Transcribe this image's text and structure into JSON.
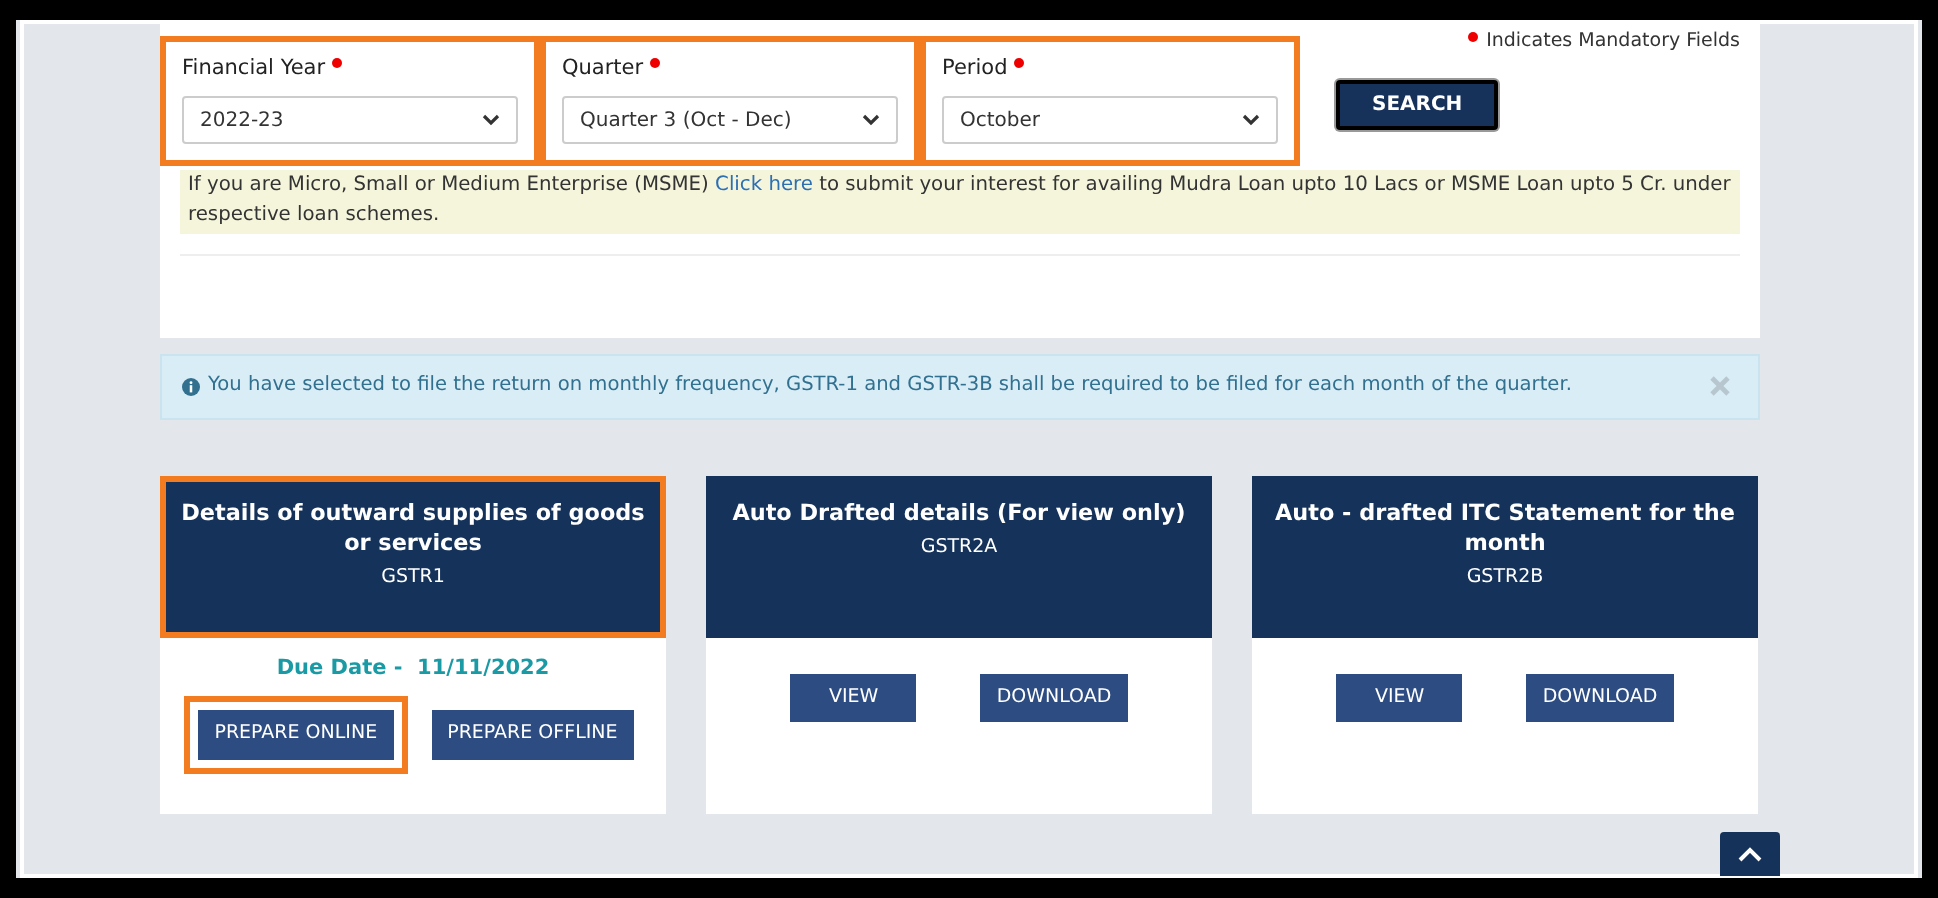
{
  "mandatory_note": {
    "text": "Indicates Mandatory Fields"
  },
  "filters": [
    {
      "label": "Financial Year",
      "value": "2022-23",
      "required": true,
      "highlighted": true
    },
    {
      "label": "Quarter",
      "value": "Quarter 3 (Oct - Dec)",
      "required": true,
      "highlighted": true
    },
    {
      "label": "Period",
      "value": "October",
      "required": true,
      "highlighted": true
    }
  ],
  "search_button": "SEARCH",
  "msme_notice": {
    "before": "If you are Micro, Small or Medium Enterprise (MSME)",
    "link": "Click here",
    "after": "to submit your interest for availing Mudra Loan upto 10 Lacs or MSME Loan upto 5 Cr. under respective loan schemes."
  },
  "info_alert": {
    "text": "You have selected to file the return on monthly frequency, GSTR-1 and GSTR-3B shall be required to be filed for each month of the quarter."
  },
  "tiles": [
    {
      "title": "Details of outward supplies of goods or services",
      "code": "GSTR1",
      "highlighted": true,
      "due_label": "Due Date -",
      "due_date": "11/11/2022",
      "buttons": [
        {
          "label": "PREPARE ONLINE",
          "highlighted": true
        },
        {
          "label": "PREPARE OFFLINE",
          "highlighted": false
        }
      ]
    },
    {
      "title": "Auto Drafted details (For view only)",
      "code": "GSTR2A",
      "highlighted": false,
      "buttons": [
        {
          "label": "VIEW",
          "highlighted": false
        },
        {
          "label": "DOWNLOAD",
          "highlighted": false
        }
      ]
    },
    {
      "title": "Auto - drafted ITC Statement for the month",
      "code": "GSTR2B",
      "highlighted": false,
      "buttons": [
        {
          "label": "VIEW",
          "highlighted": false
        },
        {
          "label": "DOWNLOAD",
          "highlighted": false
        }
      ]
    }
  ]
}
